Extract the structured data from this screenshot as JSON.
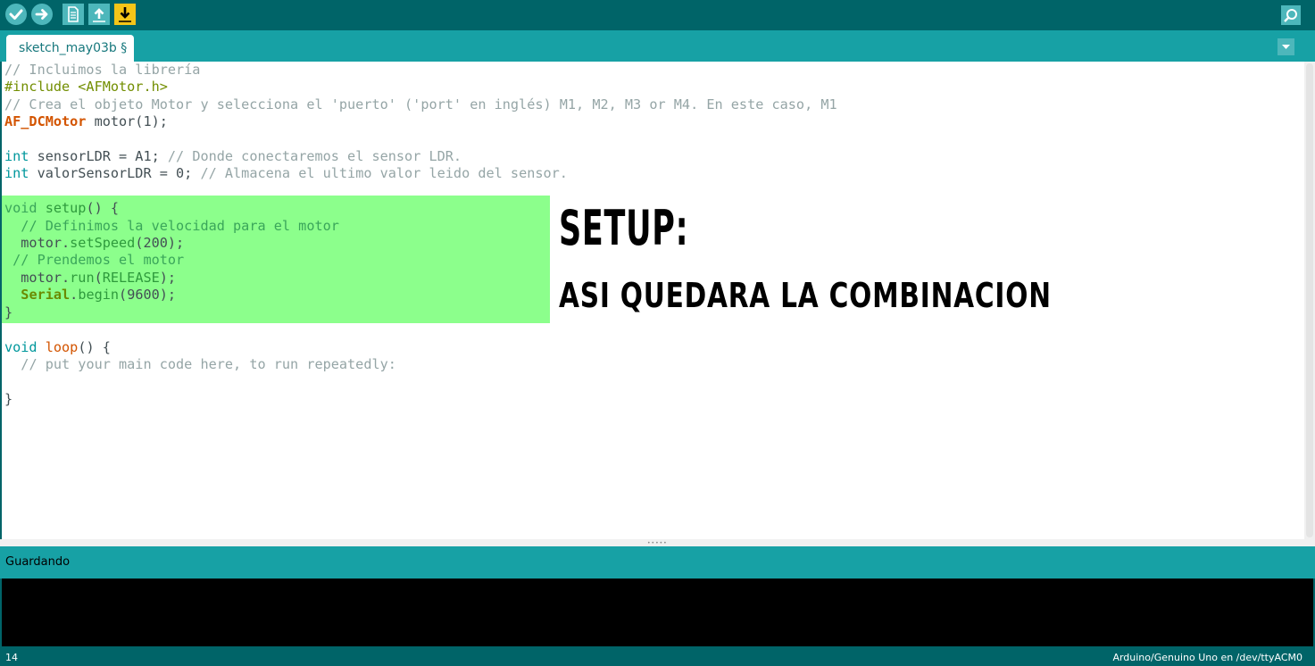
{
  "toolbar": {
    "buttons": [
      {
        "name": "verify",
        "icon": "checkmark-icon"
      },
      {
        "name": "upload",
        "icon": "arrow-right-icon"
      },
      {
        "name": "new",
        "icon": "document-icon"
      },
      {
        "name": "open",
        "icon": "arrow-up-icon"
      },
      {
        "name": "save",
        "icon": "arrow-down-icon"
      }
    ],
    "serial_monitor_icon": "magnifier-icon"
  },
  "tab": {
    "label": "sketch_may03b §",
    "menu_icon": "chevron-down-icon"
  },
  "code": {
    "lines": [
      "// Incluimos la librería",
      "#include <AFMotor.h>",
      "// Crea el objeto Motor y selecciona el 'puerto' ('port' en inglés) M1, M2, M3 or M4. En este caso, M1",
      "AF_DCMotor motor(1);",
      "",
      "int sensorLDR = A1; // Donde conectaremos el sensor LDR.",
      "int valorSensorLDR = 0; // Almacena el ultimo valor leido del sensor.",
      "",
      "void setup() {",
      "  // Definimos la velocidad para el motor",
      "  motor.setSpeed(200);",
      " // Prendemos el motor",
      "  motor.run(RELEASE);",
      "  Serial.begin(9600);",
      "}",
      "",
      "void loop() {",
      "  // put your main code here, to run repeatedly:",
      "",
      "}"
    ]
  },
  "annotation": {
    "title": "SETUP:",
    "subtitle": "ASI QUEDARA LA COMBINACION"
  },
  "status": {
    "message": "Guardando"
  },
  "footer": {
    "line_number": "14",
    "board": "Arduino/Genuino Uno en /dev/ttyACM0"
  },
  "colors": {
    "toolbar_bg": "#006468",
    "tabbar_bg": "#17a1a5",
    "button_bg": "#4db7bb",
    "save_button_bg": "#f5c518",
    "highlight": "#8cff8c"
  }
}
